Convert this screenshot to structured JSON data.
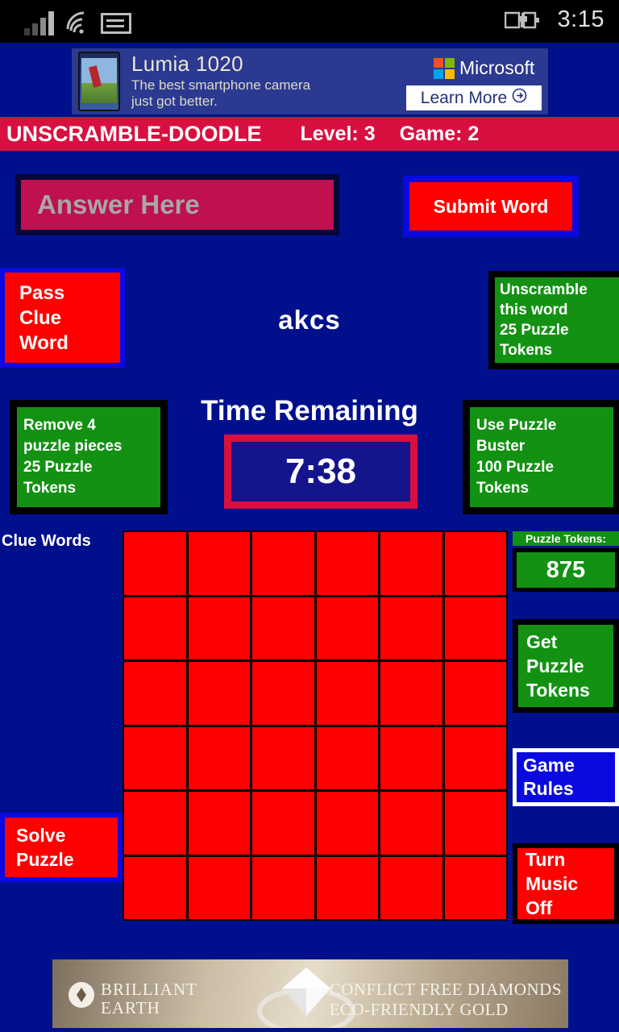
{
  "statusbar": {
    "signal_icon": "signal-bars-icon",
    "wifi_icon": "wifi-icon",
    "sim_icon": "sim-card-icon",
    "battery_icon": "battery-charging-icon",
    "time": "3:15"
  },
  "ad_top": {
    "headline": "Lumia 1020",
    "line1": "The best smartphone camera",
    "line2": "just got better.",
    "brand": "Microsoft",
    "cta": "Learn More",
    "cta_icon": "arrow-right-circle-icon"
  },
  "titlebar": {
    "app_name": "UNSCRAMBLE-DOODLE",
    "level": "Level: 3",
    "game": "Game: 2",
    "bg": "#d81040"
  },
  "answer": {
    "placeholder": "Answer Here",
    "value": "",
    "submit_label": "Submit Word"
  },
  "pass_clue": {
    "line1": "Pass",
    "line2": "Clue",
    "line3": "Word"
  },
  "clue_word": "akcs",
  "unscramble": {
    "line1": "Unscramble",
    "line2": "this word",
    "line3": "25 Puzzle",
    "line4": "Tokens"
  },
  "remove_pieces": {
    "line1": "Remove 4",
    "line2": "puzzle pieces",
    "line3": "25 Puzzle",
    "line4": "Tokens"
  },
  "timer": {
    "label": "Time Remaining",
    "value": "7:38"
  },
  "puzzle_buster": {
    "line1": "Use Puzzle",
    "line2": "Buster",
    "line3": "100 Puzzle",
    "line4": "Tokens"
  },
  "clue_words_label": "Clue Words",
  "solve": {
    "line1": "Solve",
    "line2": "Puzzle"
  },
  "tokens": {
    "header": "Puzzle Tokens:",
    "count": "875"
  },
  "get_tokens": {
    "line1": "Get",
    "line2": "Puzzle",
    "line3": "Tokens"
  },
  "game_rules": {
    "line1": "Game",
    "line2": "Rules"
  },
  "music": {
    "line1": "Turn",
    "line2": "Music",
    "line3": "Off"
  },
  "grid": {
    "rows": 6,
    "cols": 6,
    "cell_color": "#fe0000"
  },
  "ad_bottom": {
    "brand_line1": "BRILLIANT",
    "brand_line2": "EARTH",
    "tag_line1": "CONFLICT FREE DIAMONDS",
    "tag_line2": "ECO-FRIENDLY GOLD",
    "logo_icon": "diamond-logo-icon",
    "image": "diamond-ring-photo"
  },
  "colors": {
    "background": "#00108c",
    "accent_red": "#fe0000",
    "accent_green": "#139113",
    "accent_blue": "#0a0ae0",
    "accent_crimson": "#d81040"
  }
}
